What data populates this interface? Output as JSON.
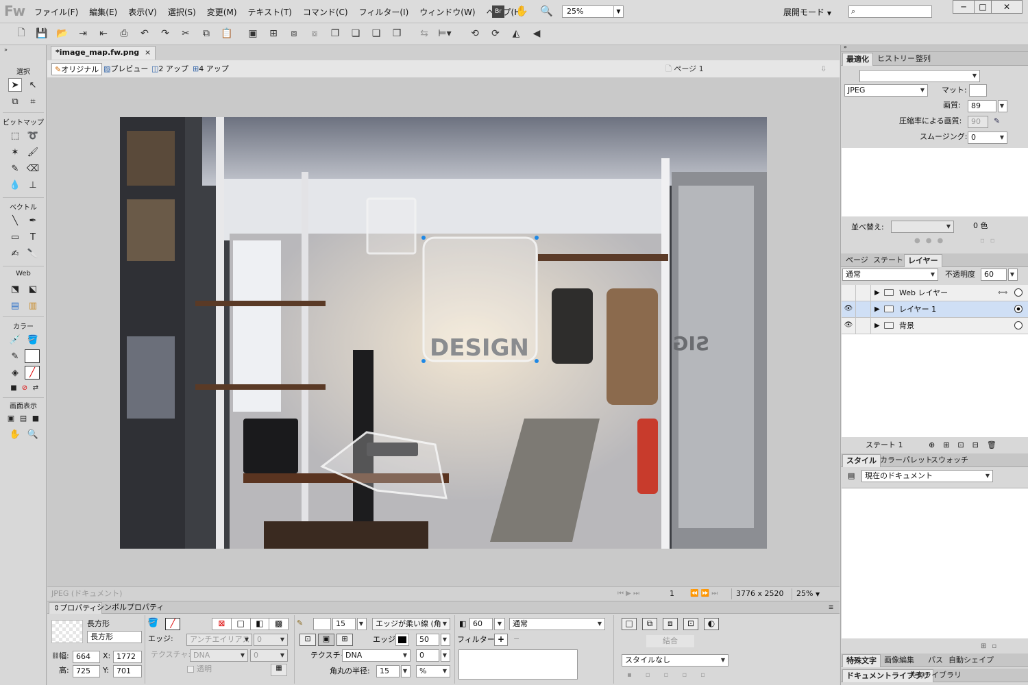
{
  "app": {
    "logo": "Fw",
    "menu": [
      "ファイル(F)",
      "編集(E)",
      "表示(V)",
      "選択(S)",
      "変更(M)",
      "テキスト(T)",
      "コマンド(C)",
      "フィルター(I)",
      "ウィンドウ(W)",
      "ヘルプ(H)"
    ],
    "br": "Br",
    "zoom": "25%",
    "mode": "展開モード",
    "win_min": "─",
    "win_max": "□",
    "win_close": "✕"
  },
  "tools": {
    "select": "選択",
    "bitmap": "ビットマップ",
    "vector": "ベクトル",
    "web": "Web",
    "color": "カラー",
    "view": "画面表示"
  },
  "document": {
    "tab": "*image_map.fw.png",
    "tab_close": "×",
    "views": [
      "オリジナル",
      "プレビュー",
      "2 アップ",
      "4 アップ"
    ],
    "page": "ページ 1"
  },
  "status": {
    "type": "JPEG (ドキュメント)",
    "frame": "1",
    "size": "3776 x 2520",
    "zoom": "25%"
  },
  "properties": {
    "tabs": [
      "プロパティ",
      "シンボルプロパティ"
    ],
    "kind": "長方形",
    "name": "長方形",
    "w_label": "幅:",
    "w": "664",
    "x_label": "X:",
    "x": "1772",
    "h_label": "高:",
    "h": "725",
    "y_label": "Y:",
    "y": "701",
    "edge_label": "エッジ:",
    "edge": "アンチエイリアス",
    "edge_val": "0",
    "texture_label": "テクスチャ:",
    "texture": "DNA",
    "texture_val": "0",
    "transparent": "透明",
    "stroke_size": "15",
    "stroke_type": "エッジが柔い線 (角",
    "stroke_edge_label": "エッジ:",
    "stroke_edge": "50",
    "stroke_texture_label": "テクスチャ:",
    "stroke_texture": "DNA",
    "stroke_texture_val": "0",
    "radius_label": "角丸の半径:",
    "radius": "15",
    "radius_unit": "%",
    "opacity": "60",
    "blend": "通常",
    "filter_label": "フィルター:",
    "combine": "結合",
    "style": "スタイルなし"
  },
  "optimize": {
    "tabs": [
      "最適化",
      "ヒストリー",
      "整列"
    ],
    "format": "JPEG",
    "matte_label": "マット:",
    "quality_label": "画質:",
    "quality": "89",
    "selective_label": "圧縮率による画質:",
    "selective": "90",
    "smoothing_label": "スムージング:",
    "smoothing": "0",
    "sort_label": "並べ替え:",
    "colors": "0 色"
  },
  "layers": {
    "tabs": [
      "ページ",
      "ステート",
      "レイヤー"
    ],
    "blend": "通常",
    "opacity_label": "不透明度",
    "opacity": "60",
    "rows": [
      {
        "name": "Web レイヤー",
        "eye": ""
      },
      {
        "name": "レイヤー 1",
        "eye": "👁"
      },
      {
        "name": "背景",
        "eye": "👁"
      }
    ],
    "state": "ステート 1"
  },
  "styles": {
    "tabs": [
      "スタイル",
      "カラーパレット",
      "スウォッチ"
    ],
    "doc": "現在のドキュメント"
  },
  "bottom_tabs": [
    "特殊文字",
    "画像編集",
    "パス",
    "自動シェイプ"
  ],
  "bottom_tabs2": [
    "ドキュメントライブラリ",
    "共有ライブラリ"
  ],
  "photo": {
    "wall_text": "DESIGN",
    "mirror_text": "SIG"
  }
}
